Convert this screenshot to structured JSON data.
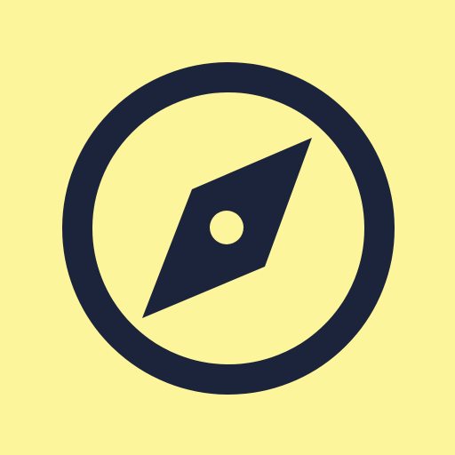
{
  "icon": {
    "name": "compass-icon",
    "background_color": "#FDF59B",
    "foreground_color": "#1C243B",
    "hub_color": "#FDF59B"
  }
}
